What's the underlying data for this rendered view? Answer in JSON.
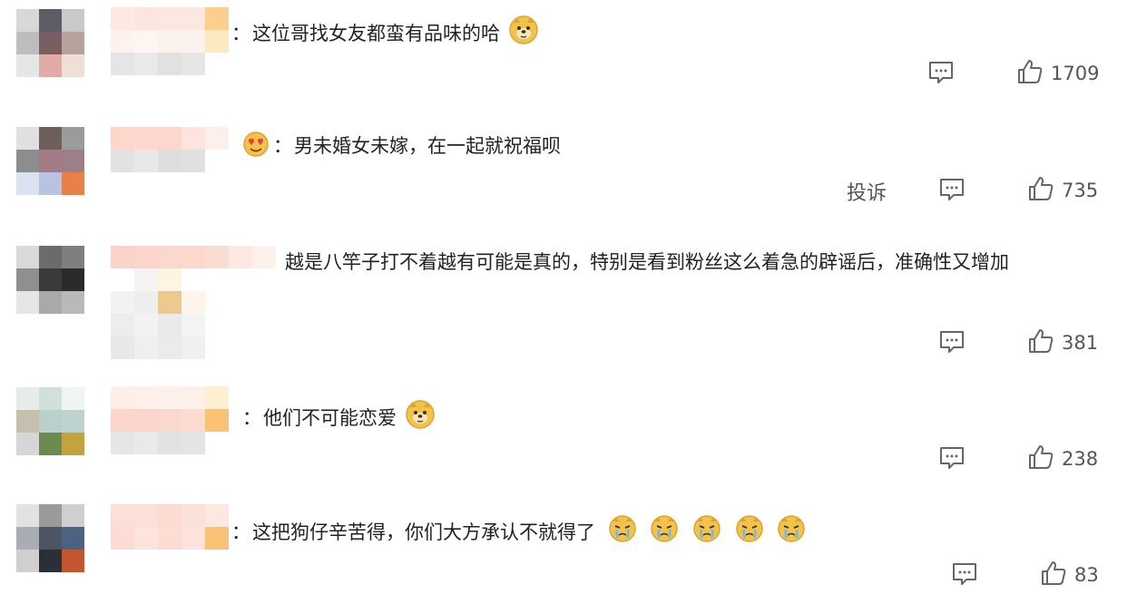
{
  "comments": [
    {
      "text": "这位哥找女友都蛮有品味的哈",
      "likes": "1709",
      "emoji_count": 1
    },
    {
      "text": "男未婚女未嫁，在一起就祝福呗",
      "likes": "735",
      "report_label": "投诉"
    },
    {
      "text": "越是八竿子打不着越有可能是真的，特别是看到粉丝这么着急的辟谣后，准确性又增加",
      "likes": "381"
    },
    {
      "text": "他们不可能恋爱",
      "likes": "238"
    },
    {
      "text": "这把狗仔辛苦得，你们大方承认不就得了",
      "likes": "83"
    }
  ],
  "separator": "：",
  "icons": {
    "reply": "comment-icon",
    "like": "thumbs-up-icon",
    "face": "doge-emoji",
    "crying": "crying-emoji",
    "heart_eyes": "heart-eyes-emoji"
  },
  "colors": {
    "text": "#222222",
    "muted": "#555555",
    "emoji": "#f4c24a"
  }
}
